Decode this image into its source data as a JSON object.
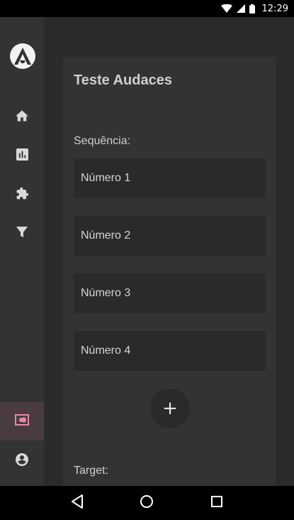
{
  "status_bar": {
    "time": "12:29",
    "icons": [
      "wifi-icon",
      "signal-icon",
      "battery-icon"
    ]
  },
  "sidebar": {
    "logo": "audaces-logo",
    "items": [
      {
        "icon": "home-icon",
        "active": false
      },
      {
        "icon": "bar-chart-icon",
        "active": false
      },
      {
        "icon": "puzzle-icon",
        "active": false
      },
      {
        "icon": "filter-icon",
        "active": false
      },
      {
        "icon": "panorama-icon",
        "active": true
      },
      {
        "icon": "account-circle-icon",
        "active": false
      }
    ],
    "active_color": "#e48aa9"
  },
  "card": {
    "title": "Teste Audaces",
    "sequence_label": "Sequência:",
    "fields": [
      "Número 1",
      "Número 2",
      "Número 3",
      "Número 4"
    ],
    "add_button_label": "+",
    "target_label": "Target:"
  },
  "navigation_bar": {
    "buttons": [
      "back-icon",
      "home-circle-icon",
      "recents-icon"
    ]
  }
}
